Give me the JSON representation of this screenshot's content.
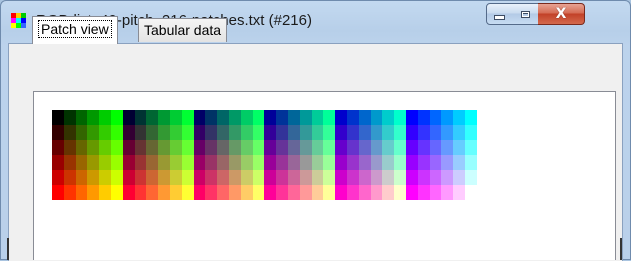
{
  "window": {
    "title": "RGB-list_49-pitch_216-patches.txt (#216)",
    "icon": "rgb-grid-icon"
  },
  "controls": {
    "minimize_icon": "minimize-icon",
    "maximize_icon": "maximize-icon",
    "close_icon": "close-icon",
    "close_glyph": "X"
  },
  "tabs": [
    {
      "label": "Patch view",
      "selected": true
    },
    {
      "label": "Tabular data",
      "selected": false
    }
  ],
  "patches": {
    "count": 216,
    "levels": [
      0,
      51,
      102,
      153,
      204,
      255
    ],
    "ordering": "blue-major blocks of 6 columns (green increasing) by 6 rows (red increasing)"
  },
  "colors": {
    "close_button": "#c24128",
    "title_bar": "#b9d0ea",
    "panel_background": "#ffffff"
  }
}
